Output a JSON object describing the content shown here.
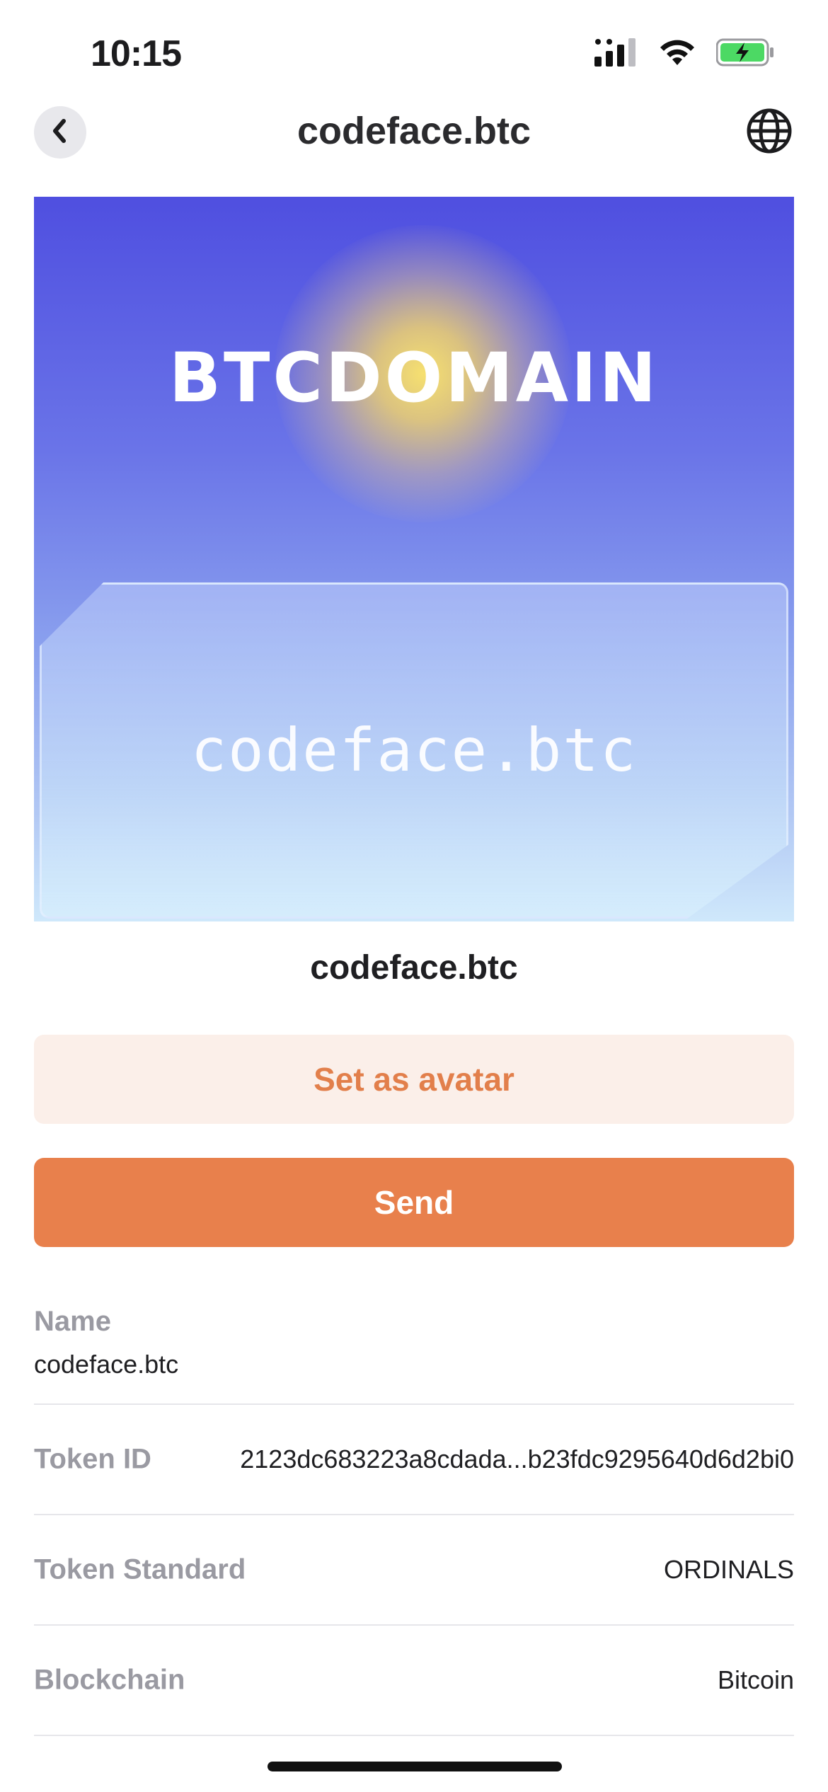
{
  "status_bar": {
    "time": "10:15",
    "icons": [
      "cellular-signal-icon",
      "wifi-icon",
      "battery-charging-icon"
    ],
    "battery_color": "#4cd964"
  },
  "nav": {
    "title": "codeface.btc",
    "back_icon": "chevron-left-icon",
    "globe_icon": "globe-icon"
  },
  "hero": {
    "brand_text": "BTCDOMAIN",
    "card_text": "codeface.btc"
  },
  "item": {
    "name": "codeface.btc"
  },
  "actions": {
    "set_avatar_label": "Set as avatar",
    "send_label": "Send"
  },
  "details": {
    "name_label": "Name",
    "name_value": "codeface.btc",
    "token_id_label": "Token ID",
    "token_id_value": "2123dc683223a8cdada...b23fdc9295640d6d2bi0",
    "token_standard_label": "Token Standard",
    "token_standard_value": "ORDINALS",
    "blockchain_label": "Blockchain",
    "blockchain_value": "Bitcoin"
  },
  "colors": {
    "accent": "#e8804c",
    "accent_light": "#fbefe9",
    "label_gray": "#9a9aa2"
  }
}
